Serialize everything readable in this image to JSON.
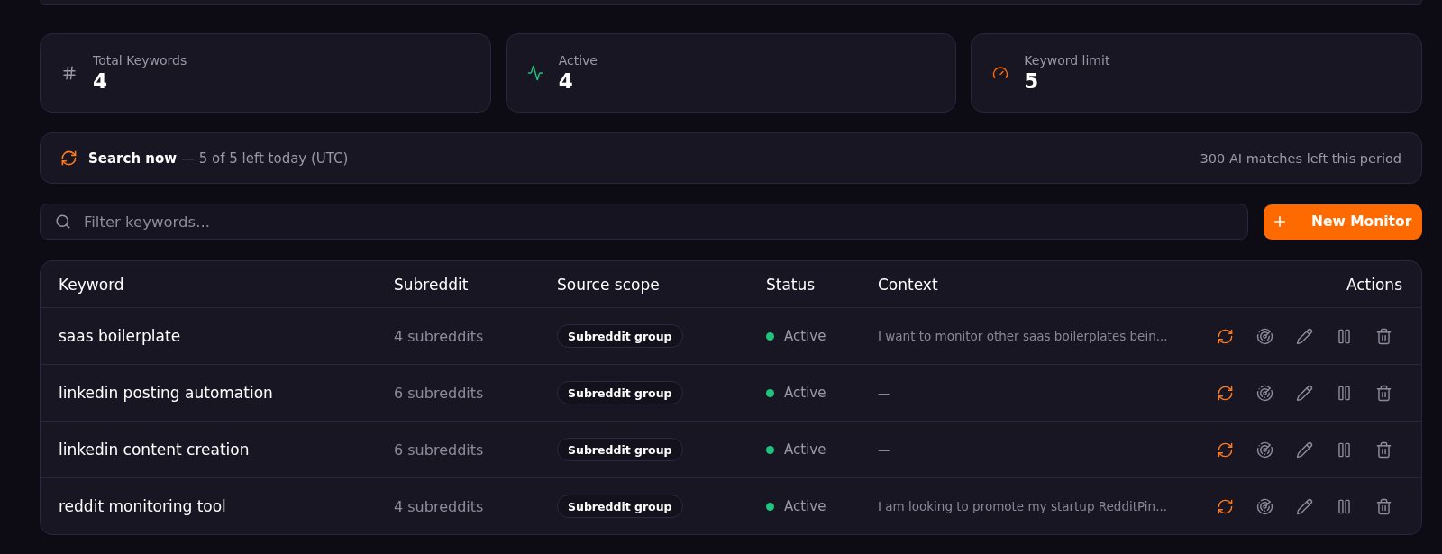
{
  "stats": [
    {
      "kind": "count",
      "label": "Total Keywords",
      "value": "4"
    },
    {
      "kind": "activity",
      "label": "Active",
      "value": "4"
    },
    {
      "kind": "limit",
      "label": "Keyword limit",
      "value": "5"
    }
  ],
  "search_bar": {
    "text": "**Search now** — 5 of 5 left today (UTC)",
    "quota": "300 AI matches left this period"
  },
  "filter": {
    "placeholder": "Filter keywords..."
  },
  "new_button": {
    "label": "New Monitor"
  },
  "table": {
    "columns": [
      "Keyword",
      "Subreddit",
      "Source scope",
      "Status",
      "Context",
      "Actions"
    ],
    "rows": [
      {
        "keyword": "saas boilerplate",
        "subreddit": "4 subreddits",
        "scope": "Subreddit group",
        "status": "Active",
        "active": true,
        "context": "I want to monitor other saas boilerplates bein..."
      },
      {
        "keyword": "linkedin posting automation",
        "subreddit": "6 subreddits",
        "scope": "Subreddit group",
        "status": "Active",
        "active": true,
        "context": "—"
      },
      {
        "keyword": "linkedin content creation",
        "subreddit": "6 subreddits",
        "scope": "Subreddit group",
        "status": "Active",
        "active": true,
        "context": "—"
      },
      {
        "keyword": "reddit monitoring tool",
        "subreddit": "4 subreddits",
        "scope": "Subreddit group",
        "status": "Active",
        "active": true,
        "context": "I am looking to promote my startup RedditPin..."
      }
    ]
  }
}
